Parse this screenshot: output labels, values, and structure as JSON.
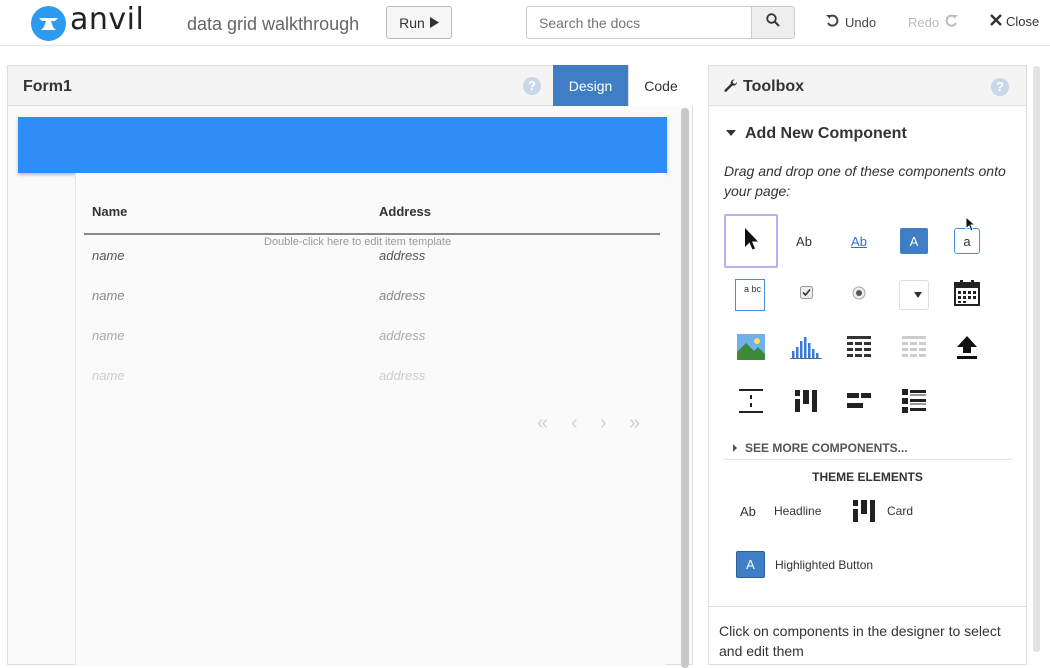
{
  "header": {
    "logo_text": "anvil",
    "app_title": "data grid walkthrough",
    "run_label": "Run",
    "search_placeholder": "Search the docs",
    "undo_label": "Undo",
    "redo_label": "Redo",
    "close_label": "Close"
  },
  "form": {
    "title": "Form1",
    "tab_design": "Design",
    "tab_code": "Code",
    "grid": {
      "columns": [
        "Name",
        "Address"
      ],
      "hint": "Double-click here to edit item template",
      "rows": [
        {
          "name": "name",
          "address": "address"
        },
        {
          "name": "name",
          "address": "address"
        },
        {
          "name": "name",
          "address": "address"
        },
        {
          "name": "name",
          "address": "address"
        }
      ],
      "pager": [
        "«",
        "‹",
        "›",
        "»"
      ]
    }
  },
  "toolbox": {
    "title": "Toolbox",
    "section_title": "Add New Component",
    "hint": "Drag and drop one of these components onto your page:",
    "see_more": "SEE MORE COMPONENTS...",
    "theme_title": "THEME ELEMENTS",
    "theme_items": {
      "headline": "Headline",
      "card": "Card",
      "highlighted_button": "Highlighted Button"
    },
    "footer": "Click on components in the designer to select and edit them",
    "label_glyph": "Ab",
    "link_glyph": "Ab",
    "button_glyph": "A",
    "textbox_glyph": "a",
    "textarea_glyph": "a bc"
  },
  "colors": {
    "accent_blue": "#2f8df7",
    "tab_active": "#3f7dc4",
    "logo_blue": "#2e9bf0"
  }
}
